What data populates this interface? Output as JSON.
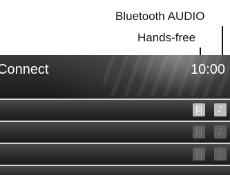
{
  "callouts": {
    "bluetooth_audio": "Bluetooth AUDIO",
    "hands_free": "Hands-free"
  },
  "screen": {
    "title": "Connect",
    "clock": "10:00"
  },
  "rows": [
    {
      "handsfree_icon": "phone-icon",
      "audio_icon": "music-note-icon",
      "state": "active"
    },
    {
      "handsfree_icon": "phone-icon",
      "audio_icon": "music-note-icon",
      "state": "inactive"
    },
    {
      "handsfree_icon": "phone-icon",
      "audio_icon": "music-note-icon",
      "state": "inactive"
    },
    {
      "state": "empty"
    }
  ],
  "colors": {
    "screen_background": "#0a0a0a",
    "separator": "#d6d6d6",
    "icon_active": "#bdbdbd",
    "icon_inactive": "#5e5e5e"
  }
}
